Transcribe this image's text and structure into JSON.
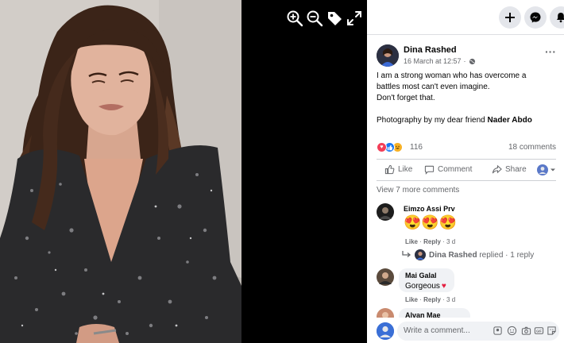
{
  "viewer": {
    "tools": [
      "zoom-in",
      "zoom-out",
      "tag",
      "fullscreen"
    ]
  },
  "topbar": {
    "buttons": [
      "plus-icon",
      "messenger-icon",
      "bell-icon"
    ]
  },
  "post": {
    "author": "Dina Rashed",
    "date": "16 March at 12:57",
    "dot": "·",
    "text_lines": [
      "I am a strong woman who has overcome a",
      "battles most can't even imagine.",
      "Don't forget that."
    ],
    "credit_prefix": "Photography by my dear friend ",
    "credit_name": "Nader Abdo",
    "reaction_count": "116",
    "comments_count": "18 comments",
    "reaction_icons": [
      "love-icon",
      "like-icon",
      "haha-icon"
    ]
  },
  "actions": {
    "like": "Like",
    "comment": "Comment",
    "share": "Share"
  },
  "comments": {
    "view_more": "View 7 more comments",
    "items": [
      {
        "name": "Eimzo Assi Prv",
        "text": "😍😍😍",
        "like": "Like",
        "reply": "Reply",
        "time": "3 d"
      },
      {
        "name": "Mai Galal",
        "text": "Gorgeous",
        "like": "Like",
        "reply": "Reply",
        "time": "3 d"
      },
      {
        "name": "Alvan Mae"
      }
    ],
    "reply_summary": {
      "name": "Dina Rashed",
      "text": " replied · 1 reply"
    }
  },
  "composer": {
    "placeholder": "Write a comment..."
  },
  "colors": {
    "accent": "#1877f2",
    "love": "#f33e58",
    "haha": "#f7b125",
    "text_secondary": "#65676b"
  }
}
